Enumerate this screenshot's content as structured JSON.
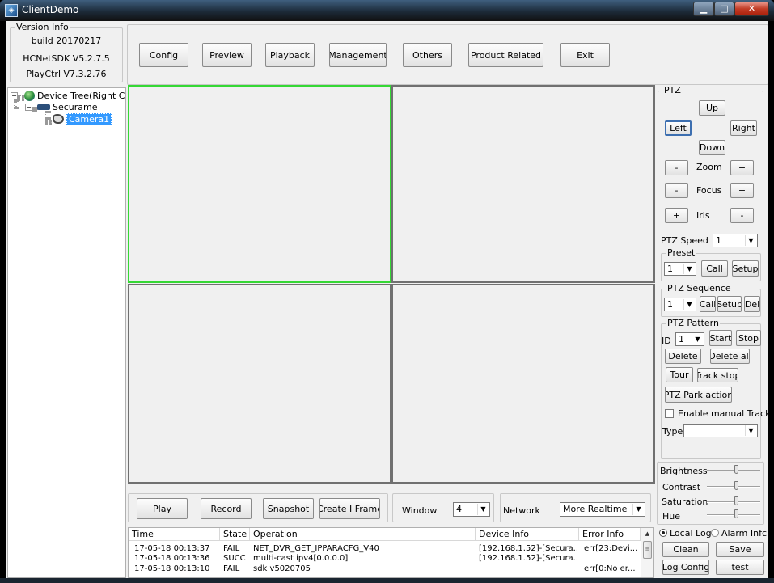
{
  "window": {
    "title": "ClientDemo",
    "app_icon": "client-demo-icon",
    "controls": [
      "minimize",
      "maximize",
      "close"
    ]
  },
  "version_info": {
    "label": "Version Info",
    "build": "build 20170217",
    "sdk": "HCNetSDK V5.2.7.5",
    "playctrl": "PlayCtrl V7.3.2.76"
  },
  "menu": {
    "config": "Config",
    "preview": "Preview",
    "playback": "Playback",
    "management": "Management",
    "others": "Others",
    "product_related": "Product Related",
    "exit": "Exit"
  },
  "tree": {
    "root": "Device Tree(Right Click t",
    "device": "Securame",
    "camera": "Camera1",
    "icons": {
      "root": "globe-icon",
      "device": "dvr-icon",
      "camera": "camera-icon"
    }
  },
  "preview": {
    "selected_pane": 0,
    "pane_count": 4
  },
  "ptz": {
    "label": "PTZ",
    "up": "Up",
    "left": "Left",
    "right": "Right",
    "down": "Down",
    "minus": "-",
    "plus": "+",
    "zoom": "Zoom",
    "focus": "Focus",
    "iris": "Iris",
    "speed_label": "PTZ Speed",
    "speed_value": "1",
    "preset": {
      "label": "Preset",
      "value": "1",
      "call": "Call",
      "setup": "Setup"
    },
    "sequence": {
      "label": "PTZ Sequence",
      "value": "1",
      "call": "Call",
      "setup": "Setup",
      "del": "Del"
    },
    "pattern": {
      "label": "PTZ Pattern",
      "id_label": "ID",
      "id_value": "1",
      "start": "Start",
      "stop": "Stop",
      "delete": "Delete",
      "delete_all": "Delete all",
      "tour": "Tour",
      "track_stop": "Track stop",
      "park": "PTZ Park action",
      "manual_track": "Enable manual Track",
      "manual_track_checked": false,
      "type_label": "Type",
      "type_value": ""
    }
  },
  "image": {
    "brightness": "Brightness",
    "contrast": "Contrast",
    "saturation": "Saturation",
    "hue": "Hue",
    "levels": [
      0.55,
      0.55,
      0.55,
      0.55
    ]
  },
  "controls": {
    "play": "Play",
    "record": "Record",
    "snapshot": "Snapshot",
    "iframe": "Create I Frame",
    "window_label": "Window",
    "window_value": "4",
    "network_label": "Network",
    "network_value": "More Realtime"
  },
  "log": {
    "local": "Local Log",
    "alarm": "Alarm Infc",
    "selected": "local",
    "clean": "Clean",
    "save": "Save",
    "log_config": "Log Config",
    "test": "test",
    "columns": [
      "Time",
      "State",
      "Operation",
      "Device Info",
      "Error Info"
    ],
    "rows": [
      [
        "17-05-18 00:13:37",
        "FAIL",
        "NET_DVR_GET_IPPARACFG_V40",
        "[192.168.1.52]-[Secura...",
        "err[23:Devi..."
      ],
      [
        "17-05-18 00:13:36",
        "SUCC",
        "multi-cast ipv4[0.0.0.0]",
        "[192.168.1.52]-[Secura...",
        ""
      ],
      [
        "17-05-18 00:13:10",
        "FAIL",
        "sdk v5020705",
        "",
        "err[0:No er..."
      ]
    ]
  },
  "colors": {
    "selected_pane_border": "#35d835",
    "tree_selection": "#3399ff",
    "client_bg": "#f0f0f0"
  }
}
